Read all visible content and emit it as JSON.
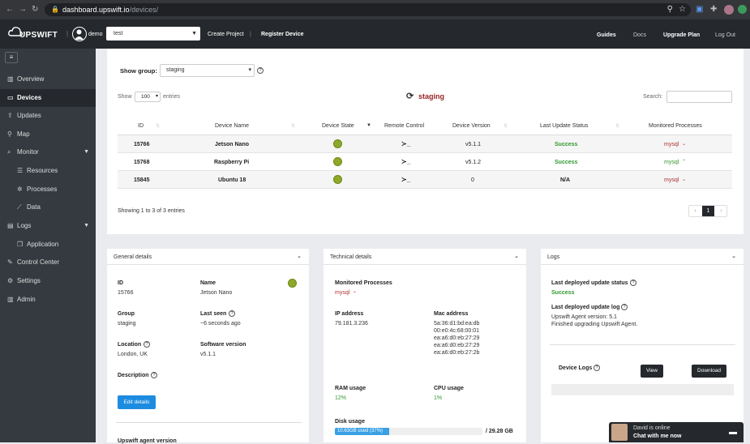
{
  "browser": {
    "url_host": "dashboard.upswift.io",
    "url_path": "/devices/"
  },
  "header": {
    "logo_text": "UPSWIFT",
    "user_name": "demo",
    "project_select": "test",
    "create_project": "Create Project",
    "register_device": "Register Device",
    "guides": "Guides",
    "docs": "Docs",
    "upgrade_plan": "Upgrade Plan",
    "logout": "Log Out"
  },
  "sidebar": {
    "items": [
      {
        "label": "Overview",
        "icon": "bar-chart-icon"
      },
      {
        "label": "Devices",
        "icon": "monitor-icon"
      },
      {
        "label": "Updates",
        "icon": "upload-icon"
      },
      {
        "label": "Map",
        "icon": "map-pin-icon"
      },
      {
        "label": "Monitor",
        "icon": "magnifier-icon"
      },
      {
        "label": "Resources",
        "icon": "list-icon"
      },
      {
        "label": "Processes",
        "icon": "cog-icon"
      },
      {
        "label": "Data",
        "icon": "line-chart-icon"
      },
      {
        "label": "Logs",
        "icon": "folder-icon"
      },
      {
        "label": "Application",
        "icon": "window-icon"
      },
      {
        "label": "Control Center",
        "icon": "wrench-icon"
      },
      {
        "label": "Settings",
        "icon": "gear-icon"
      },
      {
        "label": "Admin",
        "icon": "bar-chart-icon"
      }
    ]
  },
  "devices": {
    "show_group_label": "Show group:",
    "group_value": "staging",
    "show_label": "Show",
    "entries_value": "100",
    "entries_label": "entries",
    "group_title": "staging",
    "search_label": "Search:",
    "search_value": "",
    "columns": [
      "ID",
      "Device Name",
      "Device State",
      "Remote Control",
      "Device Version",
      "Last Update Status",
      "Monitored Processes"
    ],
    "rows": [
      {
        "id": "15766",
        "name": "Jetson Nano",
        "version": "v5.1.1",
        "status": "Success",
        "process": "mysql"
      },
      {
        "id": "15768",
        "name": "Raspberry Pi",
        "version": "v5.1.2",
        "status": "Success",
        "process": "mysql"
      },
      {
        "id": "15845",
        "name": "Ubuntu 18",
        "version": "0",
        "status": "N/A",
        "process": "mysql"
      }
    ],
    "footer_info": "Showing 1 to 3 of 3 entries",
    "pagination": {
      "prev": "‹",
      "page": "1",
      "next": "›"
    }
  },
  "general": {
    "title": "General details",
    "id_label": "ID",
    "id_value": "15766",
    "name_label": "Name",
    "name_value": "Jetson Nano",
    "group_label": "Group",
    "group_value": "staging",
    "lastseen_label": "Last seen",
    "lastseen_value": "~6 seconds ago",
    "location_label": "Location",
    "location_value": "London, UK",
    "software_label": "Software version",
    "software_value": "v5.1.1",
    "description_label": "Description",
    "edit_button": "Edit details",
    "agent_label": "Upswift agent version"
  },
  "technical": {
    "title": "Technical details",
    "monitored_label": "Monitored Processes",
    "monitored_value": "mysql",
    "ip_label": "IP address",
    "ip_value": "79.181.3.236",
    "mac_label": "Mac address",
    "mac_values": [
      "5a:36:d1:bd:ea:db",
      "00:e0:4c:68:00:01",
      "ea:a6:d0:eb:27:29",
      "ea:a6:d0:eb:27:29",
      "ea:a6:d0:eb:27:2b"
    ],
    "ram_label": "RAM usage",
    "ram_value": "12%",
    "cpu_label": "CPU usage",
    "cpu_value": "1%",
    "disk_label": "Disk usage",
    "disk_used_text": "10.63GB used (37%)",
    "disk_fraction": 0.37,
    "disk_total": "/ 29.28 GB"
  },
  "logs": {
    "title": "Logs",
    "last_status_label": "Last deployed update status",
    "last_status_value": "Success",
    "last_log_label": "Last deployed update log",
    "log_line1": "Upswift Agent version: 5.1",
    "log_line2": "Finished upgrading Upswift Agent.",
    "device_logs_label": "Device Logs",
    "view_button": "View",
    "download_button": "Download"
  },
  "chat": {
    "line1": "David is online",
    "line2": "Chat with me now"
  },
  "colors": {
    "topbar": "#25282c",
    "sidebar": "#353a40",
    "accent_blue": "#1d8ce0",
    "success_green": "#2e9a2e",
    "process_red": "#b03030",
    "state_green": "#8ea82a"
  }
}
